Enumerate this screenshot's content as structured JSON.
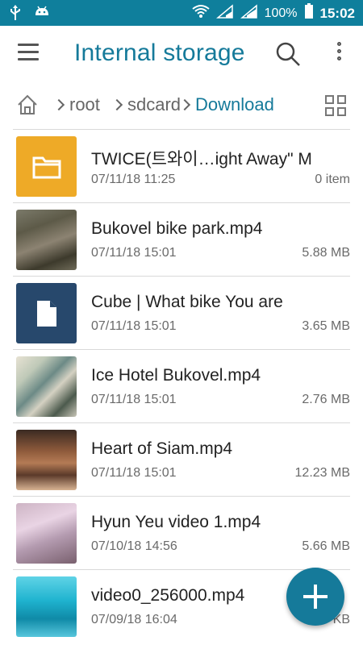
{
  "status_bar": {
    "battery_percent": "100%",
    "time": "15:02"
  },
  "app_bar": {
    "title": "Internal storage"
  },
  "breadcrumb": {
    "items": [
      "root",
      "sdcard",
      "Download"
    ]
  },
  "files": [
    {
      "name": "TWICE(트와이…ight Away\" M",
      "date": "07/11/18 11:25",
      "size": "0 item",
      "type": "folder"
    },
    {
      "name": "Bukovel bike park.mp4",
      "date": "07/11/18 15:01",
      "size": "5.88 MB",
      "type": "video"
    },
    {
      "name": "Cube | What bike You are",
      "date": "07/11/18 15:01",
      "size": "3.65 MB",
      "type": "document"
    },
    {
      "name": "Ice Hotel Bukovel.mp4",
      "date": "07/11/18 15:01",
      "size": "2.76 MB",
      "type": "video"
    },
    {
      "name": "Heart of Siam.mp4",
      "date": "07/11/18 15:01",
      "size": "12.23 MB",
      "type": "video"
    },
    {
      "name": "Hyun Yeu video 1.mp4",
      "date": "07/10/18 14:56",
      "size": "5.66 MB",
      "type": "video"
    },
    {
      "name": "video0_256000.mp4",
      "date": "07/09/18 16:04",
      "size": "329 KB",
      "type": "video"
    }
  ],
  "colors": {
    "accent": "#157a9a",
    "status_bar": "#0f7f9c",
    "folder": "#eeaa27",
    "document": "#27486c"
  }
}
